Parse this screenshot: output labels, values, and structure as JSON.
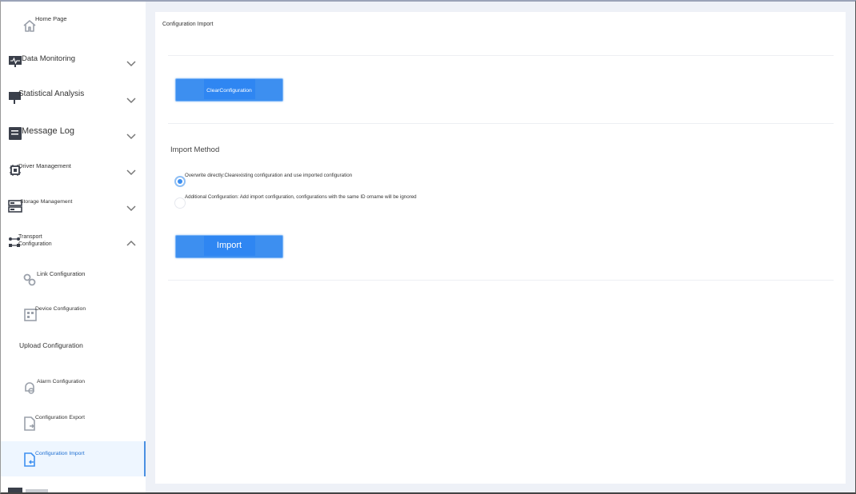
{
  "sidebar": {
    "home": "Home Page",
    "data_monitoring": "Data Monitoring",
    "statistical_analysis": "Statistical Analysis",
    "message_log": "Message Log",
    "driver_management": "Driver Management",
    "storage_management": "Storage Management",
    "transport_line1": "Transport",
    "transport_line2": "Configuration",
    "link_configuration": "Link Configuration",
    "device_configuration": "Device Configuration",
    "upload_configuration": "Upload Configuration",
    "alarm_configuration": "Alarm Configuration",
    "configuration_export": "Configuration Export",
    "configuration_import": "Configuration Import"
  },
  "main": {
    "title": "Configuration Import",
    "clear_button": "ClearConfiguration",
    "import_method_label": "Import Method",
    "option_overwrite": "Overwrite directly:Clearexisting configuration and use imported configuration",
    "option_additional": "Additional Configuration: Add import configuration, configurations with the same ID orname will be ignored",
    "import_button": "Import"
  },
  "colors": {
    "accent": "#3d8ff0",
    "active_bg": "#eef6ff",
    "page_bg": "#eef1f7"
  }
}
